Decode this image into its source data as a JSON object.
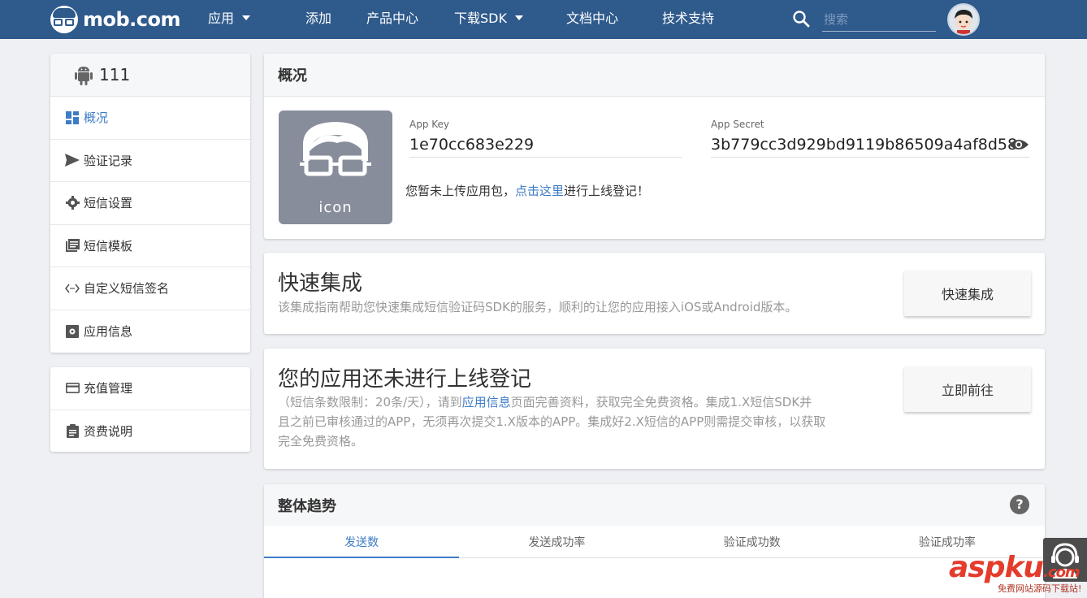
{
  "brand": {
    "name": "mob.com"
  },
  "nav": {
    "items": [
      {
        "label": "应用",
        "dropdown": true
      },
      {
        "label": "添加"
      },
      {
        "label": "产品中心"
      },
      {
        "label": "下载SDK",
        "dropdown": true
      },
      {
        "label": "文档中心"
      },
      {
        "label": "技术支持"
      }
    ],
    "search_placeholder": "搜索"
  },
  "sidebar": {
    "app_name": "111",
    "items": [
      {
        "label": "概况",
        "icon": "dashboard-icon",
        "active": true
      },
      {
        "label": "验证记录",
        "icon": "send-icon"
      },
      {
        "label": "短信设置",
        "icon": "gear-icon"
      },
      {
        "label": "短信模板",
        "icon": "template-icon"
      },
      {
        "label": "自定义短信签名",
        "icon": "code-icon"
      },
      {
        "label": "应用信息",
        "icon": "app-info-icon"
      }
    ],
    "items2": [
      {
        "label": "充值管理",
        "icon": "credit-card-icon"
      },
      {
        "label": "资费说明",
        "icon": "clipboard-icon"
      }
    ]
  },
  "overview": {
    "title": "概况",
    "icon_label": "icon",
    "app_key_label": "App Key",
    "app_key": "1e70cc683e229",
    "app_secret_label": "App Secret",
    "app_secret": "3b779cc3d929bd9119b86509a4af8d58",
    "upload_note_prefix": "您暂未上传应用包，",
    "upload_note_link": "点击这里",
    "upload_note_suffix": "进行上线登记！"
  },
  "quick_integration": {
    "title": "快速集成",
    "description": "该集成指南帮助您快速集成短信验证码SDK的服务，顺利的让您的应用接入iOS或Android版本。",
    "button": "快速集成"
  },
  "registration": {
    "title": "您的应用还未进行上线登记",
    "desc_prefix": "（短信条数限制：20条/天），请到",
    "desc_link": "应用信息",
    "desc_line1_suffix": "页面完善资料，获取完全免费资格。集成1.X短信SDK并",
    "desc_line2": "且之前已审核通过的APP，无须再次提交1.X版本的APP。集成好2.X短信的APP则需提交审核，以获取",
    "desc_line3": "完全免费资格。",
    "button": "立即前往"
  },
  "trend": {
    "title": "整体趋势",
    "help": "?",
    "tabs": [
      "发送数",
      "发送成功率",
      "验证成功数",
      "验证成功率"
    ],
    "active_tab": 0
  },
  "watermark": {
    "main": "aspku",
    "tld": ".com",
    "sub": "免费网站源码下载站!"
  },
  "colors": {
    "nav_bg": "#2e5a8c",
    "accent": "#3d7bc6",
    "page_bg": "#eef0f3"
  }
}
